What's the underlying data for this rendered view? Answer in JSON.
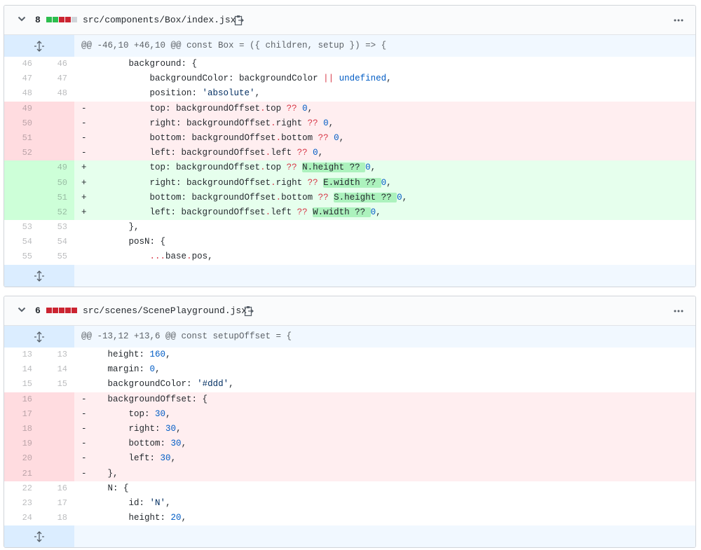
{
  "files": [
    {
      "count": "8",
      "diffstat": [
        "#2cbe4e",
        "#2cbe4e",
        "#cb2431",
        "#cb2431",
        "#d1d5da"
      ],
      "filename": "src/components/Box/index.jsx",
      "hunk_header": "@@ -46,10 +46,10 @@ const Box = ({ children, setup }) => {",
      "lines": [
        {
          "type": "ctx",
          "old": "46",
          "new": "46",
          "sign": " ",
          "indent": "        ",
          "tokens": [
            [
              "p",
              "background: {"
            ]
          ]
        },
        {
          "type": "ctx",
          "old": "47",
          "new": "47",
          "sign": " ",
          "indent": "            ",
          "tokens": [
            [
              "p",
              "backgroundColor: backgroundColor "
            ],
            [
              "k",
              "||"
            ],
            [
              "p",
              " "
            ],
            [
              "n",
              "undefined"
            ],
            [
              "p",
              ","
            ]
          ]
        },
        {
          "type": "ctx",
          "old": "48",
          "new": "48",
          "sign": " ",
          "indent": "            ",
          "tokens": [
            [
              "p",
              "position: "
            ],
            [
              "s",
              "'absolute'"
            ],
            [
              "p",
              ","
            ]
          ]
        },
        {
          "type": "del",
          "old": "49",
          "new": "",
          "sign": "-",
          "indent": "            ",
          "tokens": [
            [
              "p",
              "top: backgroundOffset"
            ],
            [
              "k",
              "."
            ],
            [
              "p",
              "top "
            ],
            [
              "k",
              "??"
            ],
            [
              "p",
              " "
            ],
            [
              "n",
              "0"
            ],
            [
              "p",
              ","
            ]
          ]
        },
        {
          "type": "del",
          "old": "50",
          "new": "",
          "sign": "-",
          "indent": "            ",
          "tokens": [
            [
              "p",
              "right: backgroundOffset"
            ],
            [
              "k",
              "."
            ],
            [
              "p",
              "right "
            ],
            [
              "k",
              "??"
            ],
            [
              "p",
              " "
            ],
            [
              "n",
              "0"
            ],
            [
              "p",
              ","
            ]
          ]
        },
        {
          "type": "del",
          "old": "51",
          "new": "",
          "sign": "-",
          "indent": "            ",
          "tokens": [
            [
              "p",
              "bottom: backgroundOffset"
            ],
            [
              "k",
              "."
            ],
            [
              "p",
              "bottom "
            ],
            [
              "k",
              "??"
            ],
            [
              "p",
              " "
            ],
            [
              "n",
              "0"
            ],
            [
              "p",
              ","
            ]
          ]
        },
        {
          "type": "del",
          "old": "52",
          "new": "",
          "sign": "-",
          "indent": "            ",
          "tokens": [
            [
              "p",
              "left: backgroundOffset"
            ],
            [
              "k",
              "."
            ],
            [
              "p",
              "left "
            ],
            [
              "k",
              "??"
            ],
            [
              "p",
              " "
            ],
            [
              "n",
              "0"
            ],
            [
              "p",
              ","
            ]
          ]
        },
        {
          "type": "add",
          "old": "",
          "new": "49",
          "sign": "+",
          "indent": "            ",
          "tokens": [
            [
              "p",
              "top: backgroundOffset"
            ],
            [
              "k",
              "."
            ],
            [
              "p",
              "top "
            ],
            [
              "k",
              "??"
            ],
            [
              "p",
              " "
            ],
            [
              "h",
              "N.height ?? "
            ],
            [
              "n",
              "0"
            ],
            [
              "p",
              ","
            ]
          ]
        },
        {
          "type": "add",
          "old": "",
          "new": "50",
          "sign": "+",
          "indent": "            ",
          "tokens": [
            [
              "p",
              "right: backgroundOffset"
            ],
            [
              "k",
              "."
            ],
            [
              "p",
              "right "
            ],
            [
              "k",
              "??"
            ],
            [
              "p",
              " "
            ],
            [
              "h",
              "E.width ?? "
            ],
            [
              "n",
              "0"
            ],
            [
              "p",
              ","
            ]
          ]
        },
        {
          "type": "add",
          "old": "",
          "new": "51",
          "sign": "+",
          "indent": "            ",
          "tokens": [
            [
              "p",
              "bottom: backgroundOffset"
            ],
            [
              "k",
              "."
            ],
            [
              "p",
              "bottom "
            ],
            [
              "k",
              "??"
            ],
            [
              "p",
              " "
            ],
            [
              "h",
              "S.height ?? "
            ],
            [
              "n",
              "0"
            ],
            [
              "p",
              ","
            ]
          ]
        },
        {
          "type": "add",
          "old": "",
          "new": "52",
          "sign": "+",
          "indent": "            ",
          "tokens": [
            [
              "p",
              "left: backgroundOffset"
            ],
            [
              "k",
              "."
            ],
            [
              "p",
              "left "
            ],
            [
              "k",
              "??"
            ],
            [
              "p",
              " "
            ],
            [
              "h",
              "W.width ?? "
            ],
            [
              "n",
              "0"
            ],
            [
              "p",
              ","
            ]
          ]
        },
        {
          "type": "ctx",
          "old": "53",
          "new": "53",
          "sign": " ",
          "indent": "        ",
          "tokens": [
            [
              "p",
              "},"
            ]
          ]
        },
        {
          "type": "ctx",
          "old": "54",
          "new": "54",
          "sign": " ",
          "indent": "        ",
          "tokens": [
            [
              "p",
              "posN: {"
            ]
          ]
        },
        {
          "type": "ctx",
          "old": "55",
          "new": "55",
          "sign": " ",
          "indent": "            ",
          "tokens": [
            [
              "k",
              "..."
            ],
            [
              "p",
              "base"
            ],
            [
              "k",
              "."
            ],
            [
              "p",
              "pos,"
            ]
          ]
        }
      ]
    },
    {
      "count": "6",
      "diffstat": [
        "#cb2431",
        "#cb2431",
        "#cb2431",
        "#cb2431",
        "#cb2431"
      ],
      "filename": "src/scenes/ScenePlayground.jsx",
      "hunk_header": "@@ -13,12 +13,6 @@ const setupOffset = {",
      "lines": [
        {
          "type": "ctx",
          "old": "13",
          "new": "13",
          "sign": " ",
          "indent": "    ",
          "tokens": [
            [
              "p",
              "height: "
            ],
            [
              "n",
              "160"
            ],
            [
              "p",
              ","
            ]
          ]
        },
        {
          "type": "ctx",
          "old": "14",
          "new": "14",
          "sign": " ",
          "indent": "    ",
          "tokens": [
            [
              "p",
              "margin: "
            ],
            [
              "n",
              "0"
            ],
            [
              "p",
              ","
            ]
          ]
        },
        {
          "type": "ctx",
          "old": "15",
          "new": "15",
          "sign": " ",
          "indent": "    ",
          "tokens": [
            [
              "p",
              "backgroundColor: "
            ],
            [
              "s",
              "'#ddd'"
            ],
            [
              "p",
              ","
            ]
          ]
        },
        {
          "type": "del",
          "old": "16",
          "new": "",
          "sign": "-",
          "indent": "    ",
          "tokens": [
            [
              "p",
              "backgroundOffset: {"
            ]
          ]
        },
        {
          "type": "del",
          "old": "17",
          "new": "",
          "sign": "-",
          "indent": "        ",
          "tokens": [
            [
              "p",
              "top: "
            ],
            [
              "n",
              "30"
            ],
            [
              "p",
              ","
            ]
          ]
        },
        {
          "type": "del",
          "old": "18",
          "new": "",
          "sign": "-",
          "indent": "        ",
          "tokens": [
            [
              "p",
              "right: "
            ],
            [
              "n",
              "30"
            ],
            [
              "p",
              ","
            ]
          ]
        },
        {
          "type": "del",
          "old": "19",
          "new": "",
          "sign": "-",
          "indent": "        ",
          "tokens": [
            [
              "p",
              "bottom: "
            ],
            [
              "n",
              "30"
            ],
            [
              "p",
              ","
            ]
          ]
        },
        {
          "type": "del",
          "old": "20",
          "new": "",
          "sign": "-",
          "indent": "        ",
          "tokens": [
            [
              "p",
              "left: "
            ],
            [
              "n",
              "30"
            ],
            [
              "p",
              ","
            ]
          ]
        },
        {
          "type": "del",
          "old": "21",
          "new": "",
          "sign": "-",
          "indent": "    ",
          "tokens": [
            [
              "p",
              "},"
            ]
          ]
        },
        {
          "type": "ctx",
          "old": "22",
          "new": "16",
          "sign": " ",
          "indent": "    ",
          "tokens": [
            [
              "p",
              "N: {"
            ]
          ]
        },
        {
          "type": "ctx",
          "old": "23",
          "new": "17",
          "sign": " ",
          "indent": "        ",
          "tokens": [
            [
              "p",
              "id: "
            ],
            [
              "s",
              "'N'"
            ],
            [
              "p",
              ","
            ]
          ]
        },
        {
          "type": "ctx",
          "old": "24",
          "new": "18",
          "sign": " ",
          "indent": "        ",
          "tokens": [
            [
              "p",
              "height: "
            ],
            [
              "n",
              "20"
            ],
            [
              "p",
              ","
            ]
          ]
        }
      ]
    }
  ]
}
